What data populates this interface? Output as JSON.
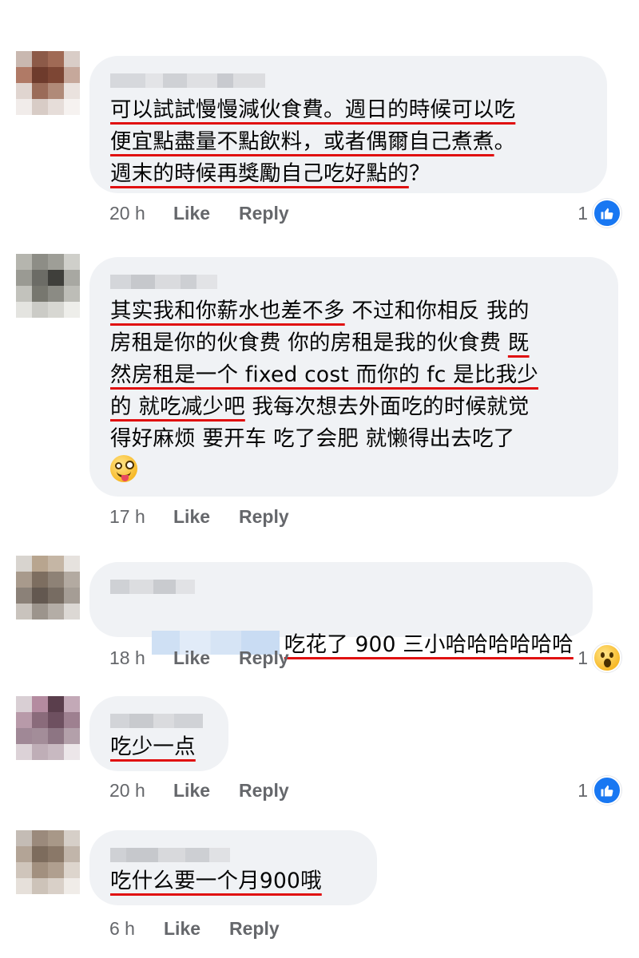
{
  "comments": [
    {
      "text_segments": [
        {
          "t": "可以試試慢慢減伙食費。週日的時候可以吃",
          "u": true
        },
        {
          "t": "\n",
          "u": false
        },
        {
          "t": "便宜點盡量不點飲料，或者偶爾自己煮煮",
          "u": true
        },
        {
          "t": "。\n",
          "u": false
        },
        {
          "t": "週末的時候再獎勵自己吃好點的",
          "u": true
        },
        {
          "t": "？",
          "u": false
        }
      ],
      "time": "20 h",
      "like_label": "Like",
      "reply_label": "Reply",
      "reaction_count": "1",
      "reaction_icon": "like-icon"
    },
    {
      "text_segments": [
        {
          "t": "其实我和你薪水也差不多",
          "u": true
        },
        {
          "t": " 不过和你相反 我的\n房租是你的伙食费 你的房租是我的伙食费 ",
          "u": false
        },
        {
          "t": "既\n然房租是一个 fixed cost 而你的 fc 是比我少\n的 就吃减少吧",
          "u": true
        },
        {
          "t": " 我每次想去外面吃的时候就觉\n得好麻烦 要开车 吃了会肥 就懒得出去吃了\n",
          "u": false
        }
      ],
      "emoji": "zany-face-emoji",
      "time": "17 h",
      "like_label": "Like",
      "reply_label": "Reply",
      "reaction_count": "",
      "reaction_icon": ""
    },
    {
      "text_segments": [
        {
          "t": "吃花了 900 三小哈哈哈哈哈哈",
          "u": true
        }
      ],
      "time": "18 h",
      "like_label": "Like",
      "reply_label": "Reply",
      "reaction_count": "1",
      "reaction_icon": "wow-icon"
    },
    {
      "text_segments": [
        {
          "t": "吃少一点",
          "u": true
        }
      ],
      "time": "20 h",
      "like_label": "Like",
      "reply_label": "Reply",
      "reaction_count": "1",
      "reaction_icon": "like-icon"
    },
    {
      "text_segments": [
        {
          "t": "吃什么要一个月900哦",
          "u": true
        }
      ],
      "time": "6 h",
      "like_label": "Like",
      "reply_label": "Reply",
      "reaction_count": "",
      "reaction_icon": ""
    }
  ],
  "colors": {
    "bubble": "#f0f2f5",
    "meta_text": "#65676b",
    "underline": "#e01010",
    "like_blue": "#1877f2"
  }
}
